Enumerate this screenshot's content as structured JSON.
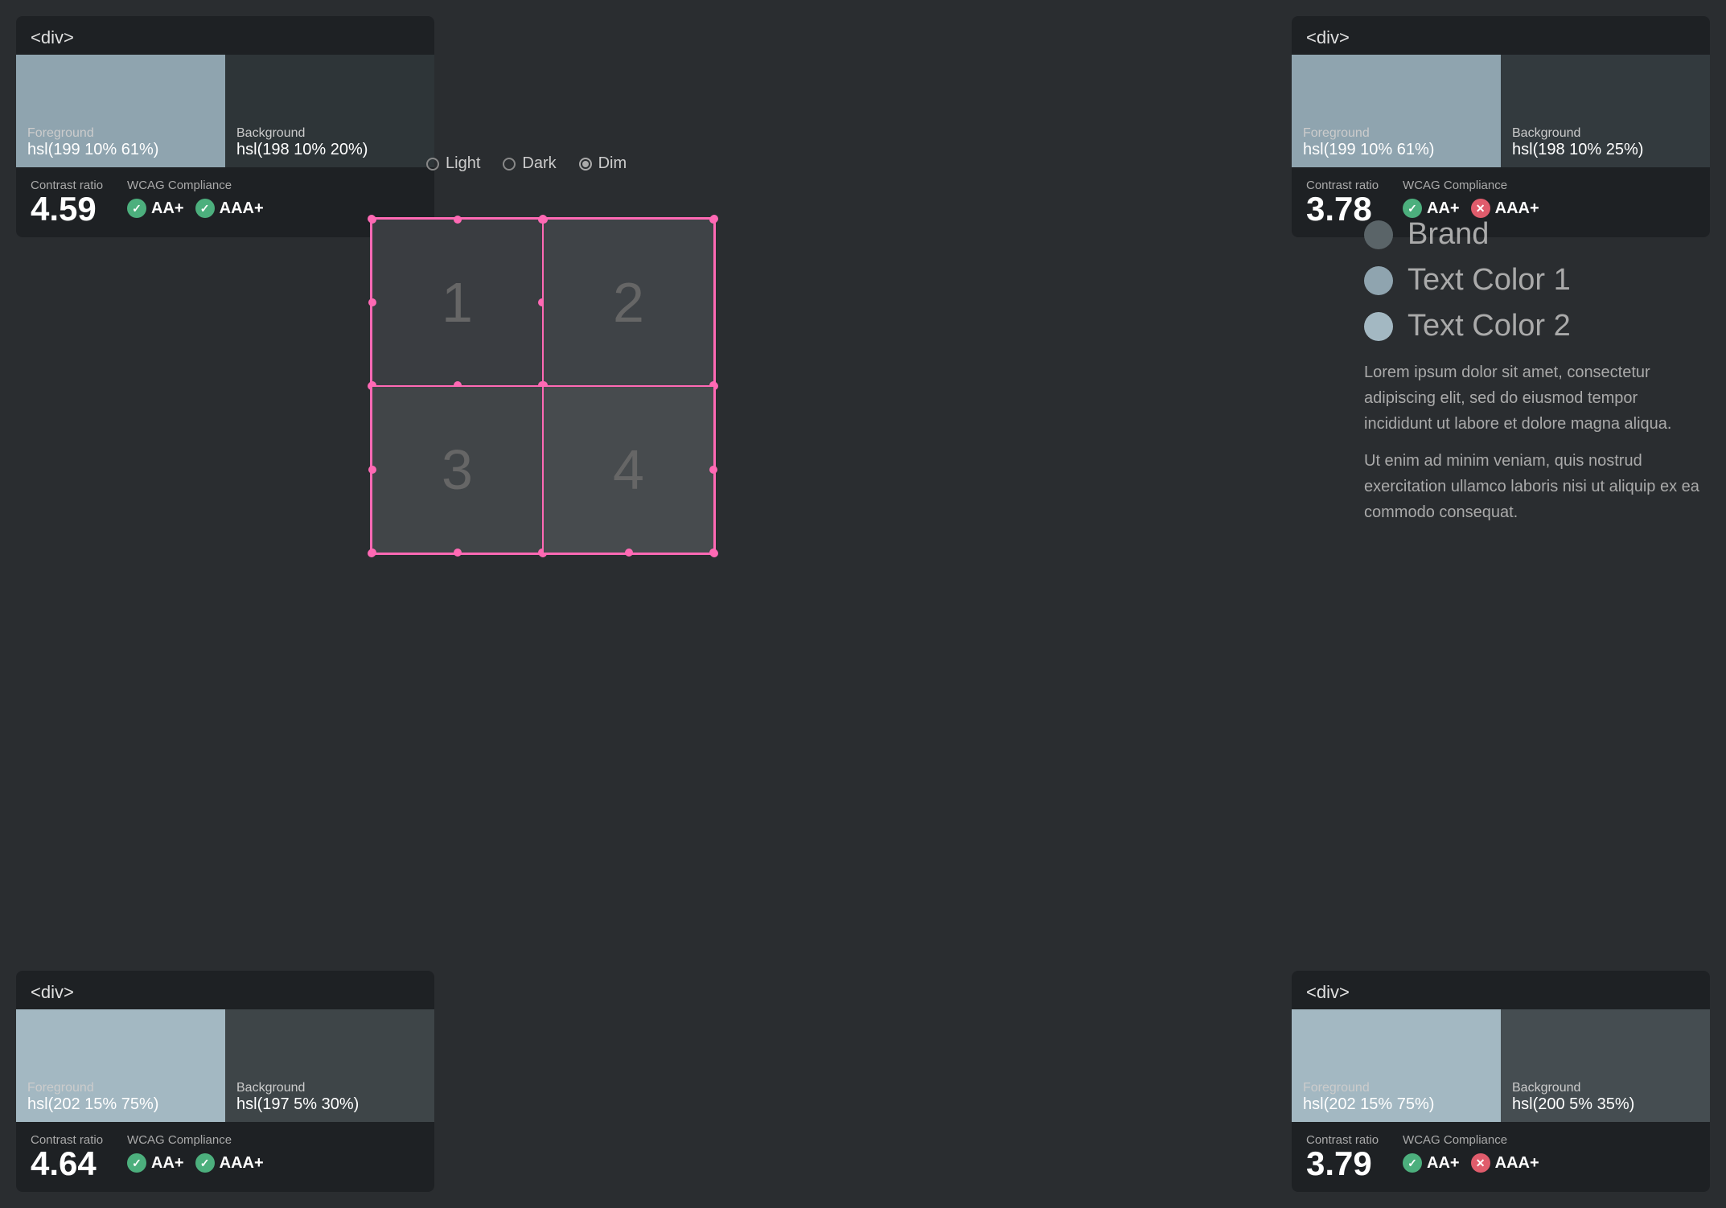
{
  "cards": {
    "top_left": {
      "header": "<div>",
      "foreground_label": "Foreground",
      "foreground_value": "hsl(199 10% 61%)",
      "background_label": "Background",
      "background_value": "hsl(198 10% 20%)",
      "contrast_label": "Contrast ratio",
      "contrast_value": "4.59",
      "wcag_label": "WCAG Compliance",
      "aa_label": "AA+",
      "aaa_label": "AAA+",
      "aa_pass": true,
      "aaa_pass": true
    },
    "top_right": {
      "header": "<div>",
      "foreground_label": "Foreground",
      "foreground_value": "hsl(199 10% 61%)",
      "background_label": "Background",
      "background_value": "hsl(198 10% 25%)",
      "contrast_label": "Contrast ratio",
      "contrast_value": "3.78",
      "wcag_label": "WCAG Compliance",
      "aa_label": "AA+",
      "aaa_label": "AAA+",
      "aa_pass": true,
      "aaa_pass": false
    },
    "bottom_left": {
      "header": "<div>",
      "foreground_label": "Foreground",
      "foreground_value": "hsl(202 15% 75%)",
      "background_label": "Background",
      "background_value": "hsl(197 5% 30%)",
      "contrast_label": "Contrast ratio",
      "contrast_value": "4.64",
      "wcag_label": "WCAG Compliance",
      "aa_label": "AA+",
      "aaa_label": "AAA+",
      "aa_pass": true,
      "aaa_pass": true
    },
    "bottom_right": {
      "header": "<div>",
      "foreground_label": "Foreground",
      "foreground_value": "hsl(202 15% 75%)",
      "background_label": "Background",
      "background_value": "hsl(200 5% 35%)",
      "contrast_label": "Contrast ratio",
      "contrast_value": "3.79",
      "wcag_label": "WCAG Compliance",
      "aa_label": "AA+",
      "aaa_label": "AAA+",
      "aa_pass": true,
      "aaa_pass": false
    }
  },
  "mode_selector": {
    "options": [
      "Light",
      "Dark",
      "Dim"
    ],
    "selected": "Dim"
  },
  "grid": {
    "cells": [
      "1",
      "2",
      "3",
      "4"
    ]
  },
  "legend": {
    "items": [
      {
        "label": "Brand",
        "color": "#5a6468"
      },
      {
        "label": "Text Color 1",
        "color": "#8fa4af"
      },
      {
        "label": "Text Color 2",
        "color": "#a3b8c2"
      }
    ]
  },
  "lorem": {
    "p1": "Lorem ipsum dolor sit amet, consectetur adipiscing elit, sed do eiusmod tempor incididunt ut labore et dolore magna aliqua.",
    "p2": "Ut enim ad minim veniam, quis nostrud exercitation ullamco laboris nisi ut aliquip ex ea commodo consequat."
  }
}
